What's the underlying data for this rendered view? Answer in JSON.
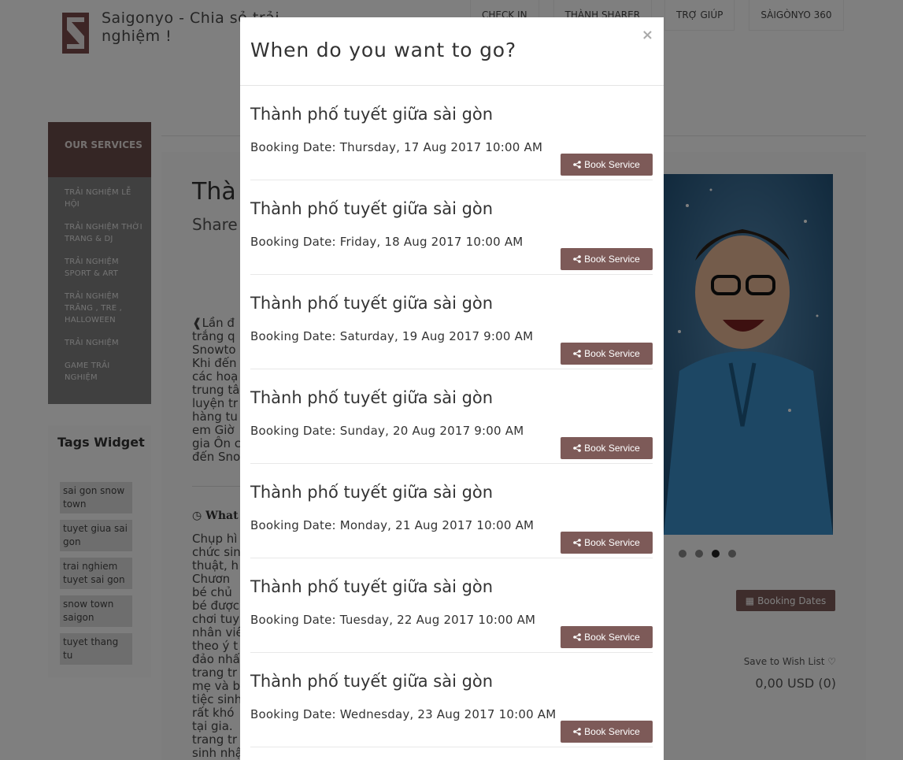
{
  "site": {
    "title": "Saigonyo - Chia sẻ trải nghiệm !"
  },
  "topnav": [
    {
      "label": "CHECK IN"
    },
    {
      "label": "THÀNH SHARER"
    },
    {
      "label": "TRỢ GIÚP"
    },
    {
      "label": "SÀIGÒNYO 360"
    }
  ],
  "sidebar": {
    "heading": "OUR SERVICES",
    "items": [
      {
        "label": "TRẢI NGHIỆM LỄ HỘI"
      },
      {
        "label": "TRẢI NGHIỆM THỜI TRANG & DJ"
      },
      {
        "label": "TRẢI NGHIỆM SPORT & ART"
      },
      {
        "label": "TRẢI NGHIỆM TRĂNG , TRE , HALLOWEEN"
      },
      {
        "label": "TRẢI NGHIỆM"
      },
      {
        "label": "GAME TRẢI NGHIỆM"
      }
    ]
  },
  "tags_widget": {
    "title": "Tags Widget",
    "tags": [
      {
        "label": "sai gon snow town"
      },
      {
        "label": "tuyet giua sai gon"
      },
      {
        "label": "trai nghiem tuyet sai gon"
      },
      {
        "label": "snow town saigon"
      },
      {
        "label": "tuyet thang tu"
      }
    ]
  },
  "background": {
    "title_fragment": "Thà",
    "share_fragment": "Share",
    "para1_fragment": "Lần đ trắng q Snowto Khi đến các hoạ trung tâ luyện tr hàng tu em Giờ gia Ôn c đến Sno",
    "what_fragment": "What",
    "para2_fragment": "Chụp hì chức sin thuật, h -Chươn bé chủ bé được chơi tuy nhân viê theo ý t đảo nhấ trang tr mẹ và b tiệc sinh rất khó tại gia. trang tr sinh nhậ",
    "slider_dots": 4,
    "active_dot": 3,
    "booking_dates_label": "Booking Dates",
    "wish_list_label": "Save to Wish List",
    "price": "0,00 USD (0)"
  },
  "modal": {
    "title": "When do you want to go?",
    "close_label": "×",
    "book_label": "Book Service",
    "items": [
      {
        "title": "Thành phố tuyết giữa sài gòn",
        "date": "Booking Date: Thursday, 17 Aug 2017 10:00 AM"
      },
      {
        "title": "Thành phố tuyết giữa sài gòn",
        "date": "Booking Date: Friday, 18 Aug 2017 10:00 AM"
      },
      {
        "title": "Thành phố tuyết giữa sài gòn",
        "date": "Booking Date: Saturday, 19 Aug 2017 9:00 AM"
      },
      {
        "title": "Thành phố tuyết giữa sài gòn",
        "date": "Booking Date: Sunday, 20 Aug 2017 9:00 AM"
      },
      {
        "title": "Thành phố tuyết giữa sài gòn",
        "date": "Booking Date: Monday, 21 Aug 2017 10:00 AM"
      },
      {
        "title": "Thành phố tuyết giữa sài gòn",
        "date": "Booking Date: Tuesday, 22 Aug 2017 10:00 AM"
      },
      {
        "title": "Thành phố tuyết giữa sài gòn",
        "date": "Booking Date: Wednesday, 23 Aug 2017 10:00 AM"
      }
    ]
  },
  "colors": {
    "brand": "#7d5a58",
    "sidebar_head": "#6b4c4a",
    "sidebar_bg": "#808080"
  }
}
